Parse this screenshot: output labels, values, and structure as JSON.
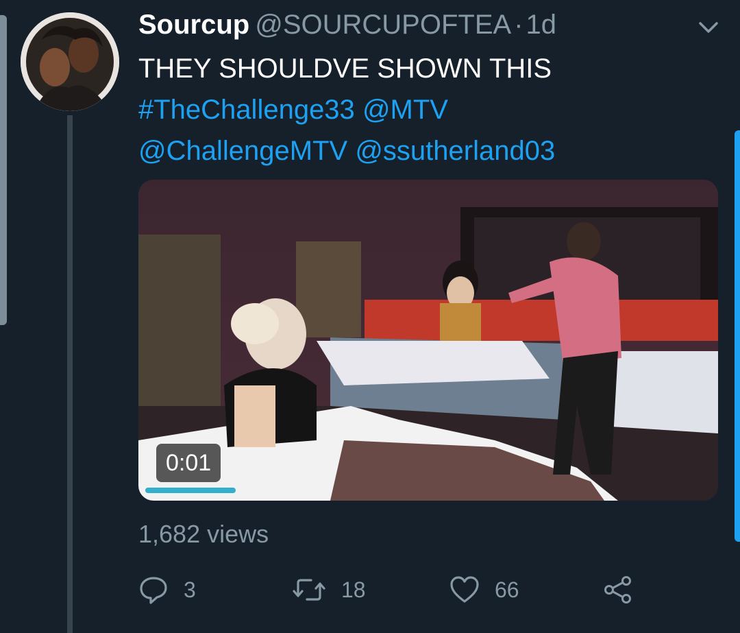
{
  "tweet": {
    "display_name": "Sourcup",
    "handle": "@SOURCUPOFTEA",
    "separator": "·",
    "time": "1d",
    "text_line1": "THEY SHOULDVE SHOWN THIS",
    "hashtag": "#TheChallenge33",
    "mention1": "@MTV",
    "mention2": "@ChallengeMTV",
    "mention3": "@ssutherland03",
    "views": "1,682 views"
  },
  "media": {
    "type": "video",
    "duration": "0:01",
    "progress": 0.16
  },
  "actions": {
    "reply_count": "3",
    "retweet_count": "18",
    "like_count": "66"
  },
  "icons": {
    "chevron": "chevron-down-icon",
    "reply": "reply-icon",
    "retweet": "retweet-icon",
    "like": "heart-icon",
    "share": "share-icon"
  },
  "colors": {
    "background": "#15202b",
    "link": "#1da1f2",
    "secondary_text": "#8899a6",
    "video_progress": "#34aeca"
  }
}
